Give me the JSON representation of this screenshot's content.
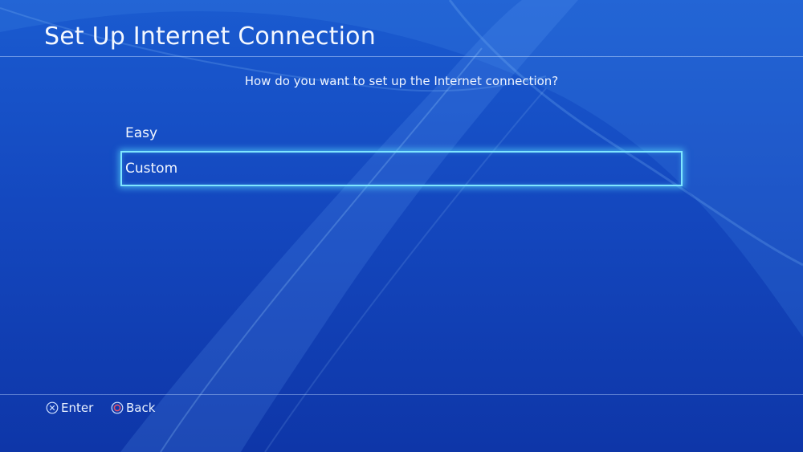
{
  "header": {
    "title": "Set Up Internet Connection"
  },
  "main": {
    "prompt": "How do you want to set up the Internet connection?",
    "options": [
      {
        "label": "Easy",
        "selected": false
      },
      {
        "label": "Custom",
        "selected": true
      }
    ]
  },
  "footer": {
    "enter_label": "Enter",
    "back_label": "Back",
    "enter_icon": "cross-button-icon",
    "back_icon": "circle-button-icon"
  },
  "colors": {
    "background": "#1448bf",
    "focus_outline": "#7fe6ff",
    "circle_button": "#e0506a"
  }
}
